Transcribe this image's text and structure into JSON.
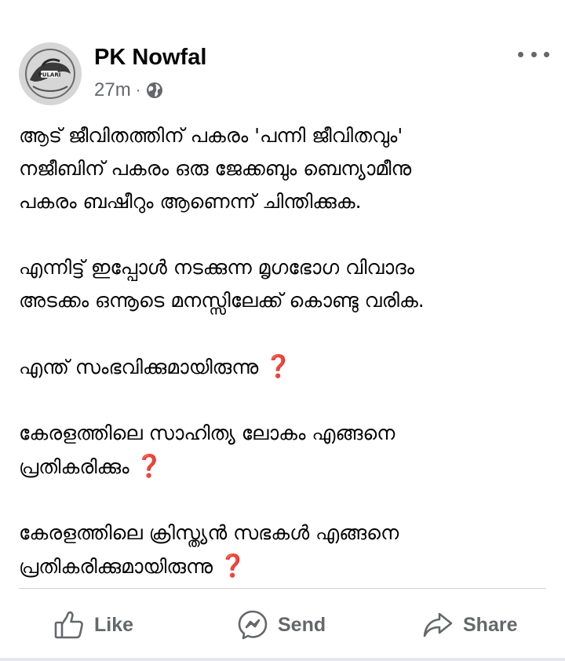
{
  "post": {
    "author": "PK Nowfal",
    "time": "27m",
    "separator": "·",
    "privacy_icon": "globe-icon",
    "menu_icon": "more-options-icon",
    "avatar_text": "PULARI",
    "paragraphs": [
      [
        "ആട് ജീവിതത്തിന് പകരം 'പന്നി ജീവിതവും'",
        "നജീബിന് പകരം ഒരു ജേക്കബും  ബെന്യാമീനു",
        "പകരം ബഷീറും ആണെന്ന് ചിന്തിക്കുക."
      ],
      [
        "എന്നിട്ട് ഇപ്പോൾ നടക്കുന്ന മൃഗഭോഗ വിവാദം",
        "അടക്കം ഒന്നൂടെ മനസ്സിലേക്ക് കൊണ്ടു വരിക."
      ],
      [
        "എന്ത് സംഭവിക്കുമായിരുന്നു ❓"
      ],
      [
        "കേരളത്തിലെ സാഹിത്യ ലോകം എങ്ങനെ",
        "പ്രതികരിക്കും ❓"
      ],
      [
        "കേരളത്തിലെ ക്രിസ്ത്യൻ സഭകൾ എങ്ങനെ",
        "പ്രതികരിക്കുമായിരുന്നു ❓"
      ]
    ]
  },
  "actions": {
    "like": {
      "label": "Like",
      "icon": "thumbs-up-icon"
    },
    "send": {
      "label": "Send",
      "icon": "messenger-icon"
    },
    "share": {
      "label": "Share",
      "icon": "share-arrow-icon"
    }
  },
  "colors": {
    "text": "#050505",
    "secondary": "#65676b",
    "divider": "#d0d2d6",
    "question_mark": "#dd2e44"
  }
}
